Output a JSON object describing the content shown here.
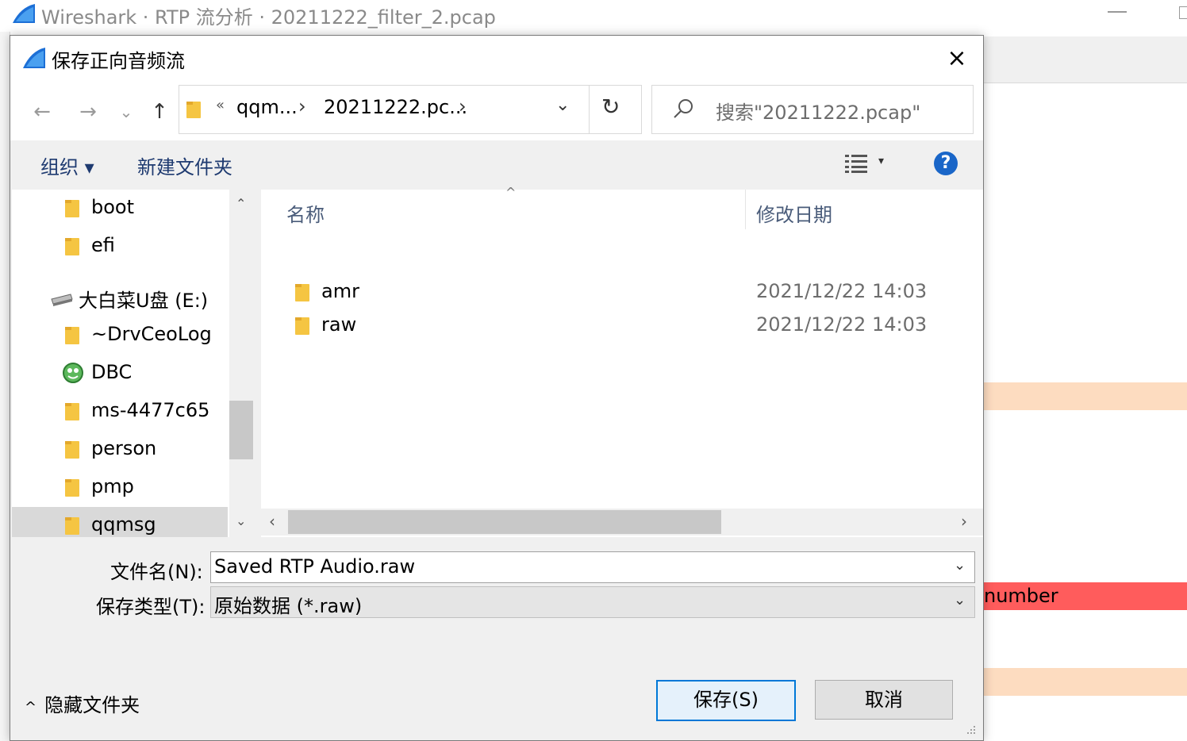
{
  "app_window": {
    "title": "Wireshark · RTP 流分析 · 20211222_filter_2.pcap",
    "background_row_text": "number",
    "colors": {
      "peach_row": "#fddcc0",
      "red_row": "#ff5c5c"
    }
  },
  "dialog": {
    "title": "保存正向音频流",
    "close_icon": "×",
    "nav": {
      "back_icon": "←",
      "forward_icon": "→",
      "recent_icon": "⌄",
      "up_icon": "↑"
    },
    "address": {
      "overflow": "«",
      "segments": [
        "qqm...",
        "20211222.pc..."
      ],
      "separator": "›",
      "dropdown_icon": "⌄",
      "refresh_icon": "↻"
    },
    "search": {
      "placeholder": "搜索\"20211222.pcap\""
    },
    "commands": {
      "organize": "组织 ▾",
      "new_folder": "新建文件夹",
      "view_dropdown": "▾",
      "help": "?"
    },
    "tree": {
      "up_arrow": "⌃",
      "down_arrow": "⌄",
      "items": [
        {
          "label": "boot",
          "icon": "folder-icon"
        },
        {
          "label": "efi",
          "icon": "folder-icon"
        },
        {
          "label": "大白菜U盘 (E:)",
          "icon": "usb-drive-icon"
        },
        {
          "label": "~DrvCeoLog",
          "icon": "folder-icon"
        },
        {
          "label": "DBC",
          "icon": "app-folder-icon"
        },
        {
          "label": "ms-4477c65",
          "icon": "folder-icon"
        },
        {
          "label": "person",
          "icon": "folder-icon"
        },
        {
          "label": "pmp",
          "icon": "folder-icon"
        },
        {
          "label": "qqmsg",
          "icon": "folder-icon"
        }
      ]
    },
    "file_list": {
      "columns": {
        "name": "名称",
        "modified": "修改日期"
      },
      "sort_indicator": "^",
      "rows": [
        {
          "name": "amr",
          "modified": "2021/12/22 14:03"
        },
        {
          "name": "raw",
          "modified": "2021/12/22 14:03"
        }
      ],
      "scroll_left": "‹",
      "scroll_right": "›"
    },
    "form": {
      "filename_label": "文件名(N):",
      "filename_value": "Saved RTP Audio.raw",
      "filetype_label": "保存类型(T):",
      "filetype_value": "原始数据 (*.raw)",
      "dropdown_icon": "⌄"
    },
    "hide_folders": {
      "caret": "^",
      "label": "隐藏文件夹"
    },
    "buttons": {
      "save": "保存(S)",
      "cancel": "取消"
    },
    "accent_color": "#0078d7"
  }
}
